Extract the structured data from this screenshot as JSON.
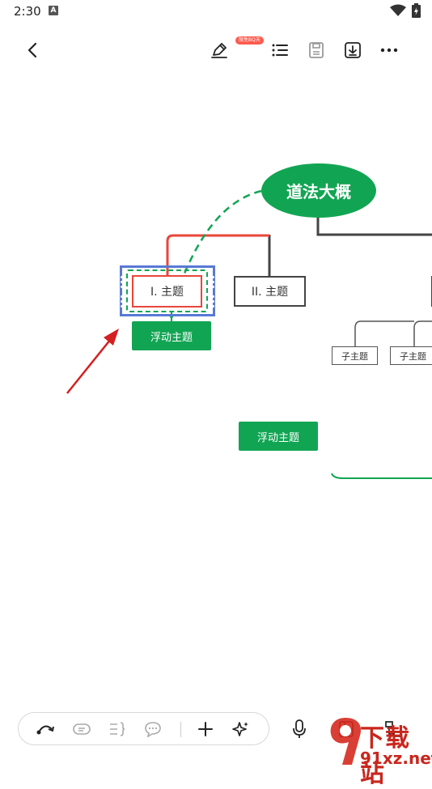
{
  "status_bar": {
    "time": "2:30",
    "notification_letter": "A"
  },
  "toolbar": {
    "badge_text": "限免BQ天"
  },
  "mindmap": {
    "central_topic": "道法大概",
    "topic_1": "I. 主题",
    "topic_2": "II. 主题",
    "floating_topic_1": "浮动主题",
    "floating_topic_2": "浮动主题",
    "subtopic_1": "子主题",
    "subtopic_2": "子主题"
  },
  "watermark": {
    "brand_top": "下载站",
    "brand_url": "91xz.net"
  },
  "colors": {
    "green": "#11a553",
    "red": "#e9463b",
    "selection_blue": "#5979d6",
    "arrow_red": "#d42020"
  },
  "icons": {
    "toolbar": [
      "back-icon",
      "pen-icon",
      "outline-list-icon",
      "save-icon",
      "download-icon",
      "more-icon"
    ],
    "bottom": [
      "relation-curve-icon",
      "label-icon",
      "summary-icon",
      "comment-icon",
      "add-icon",
      "ai-sparkle-icon",
      "microphone-icon",
      "layout-icon",
      "structure-icon"
    ]
  }
}
